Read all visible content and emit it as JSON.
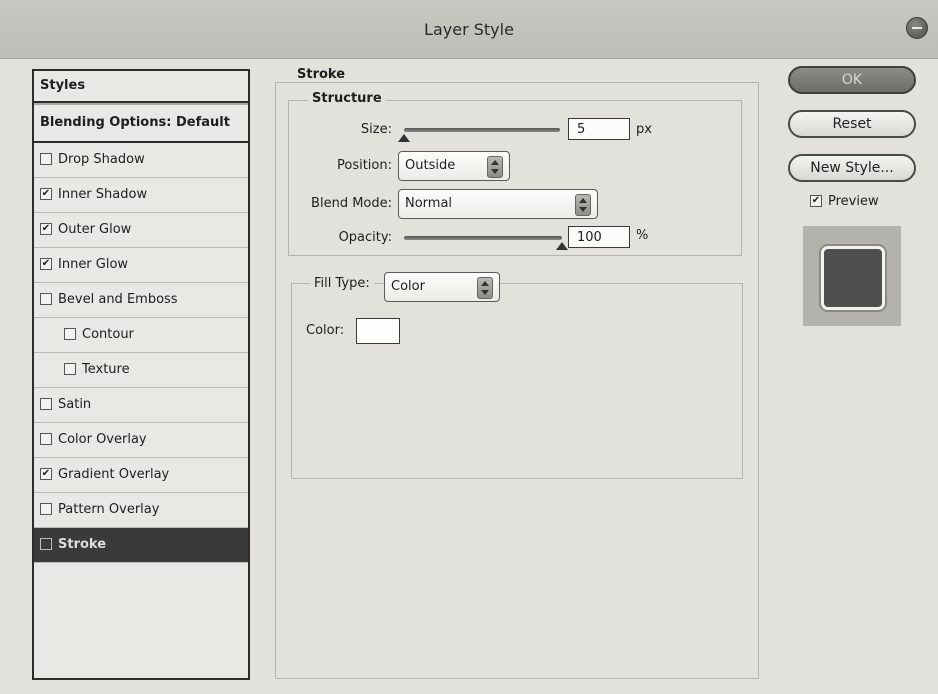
{
  "window": {
    "title": "Layer Style"
  },
  "styles_panel": {
    "header": "Styles",
    "blending_options": "Blending Options: Default",
    "items": [
      {
        "label": "Drop Shadow",
        "checked": false,
        "indent": false,
        "selected": false
      },
      {
        "label": "Inner Shadow",
        "checked": true,
        "indent": false,
        "selected": false
      },
      {
        "label": "Outer Glow",
        "checked": true,
        "indent": false,
        "selected": false
      },
      {
        "label": "Inner Glow",
        "checked": true,
        "indent": false,
        "selected": false
      },
      {
        "label": "Bevel and Emboss",
        "checked": false,
        "indent": false,
        "selected": false
      },
      {
        "label": "Contour",
        "checked": false,
        "indent": true,
        "selected": false
      },
      {
        "label": "Texture",
        "checked": false,
        "indent": true,
        "selected": false
      },
      {
        "label": "Satin",
        "checked": false,
        "indent": false,
        "selected": false
      },
      {
        "label": "Color Overlay",
        "checked": false,
        "indent": false,
        "selected": false
      },
      {
        "label": "Gradient Overlay",
        "checked": true,
        "indent": false,
        "selected": false
      },
      {
        "label": "Pattern Overlay",
        "checked": false,
        "indent": false,
        "selected": false
      },
      {
        "label": "Stroke",
        "checked": false,
        "indent": false,
        "selected": true
      }
    ]
  },
  "stroke": {
    "group_title": "Stroke",
    "structure_title": "Structure",
    "size_label": "Size:",
    "size_value": "5",
    "size_unit": "px",
    "position_label": "Position:",
    "position_value": "Outside",
    "blend_mode_label": "Blend Mode:",
    "blend_mode_value": "Normal",
    "opacity_label": "Opacity:",
    "opacity_value": "100",
    "opacity_unit": "%",
    "fill_type_label": "Fill Type:",
    "fill_type_value": "Color",
    "color_label": "Color:",
    "color_value": "#fdfdfc"
  },
  "buttons": {
    "ok": "OK",
    "reset": "Reset",
    "new_style": "New Style...",
    "preview_label": "Preview",
    "preview_checked": true
  }
}
